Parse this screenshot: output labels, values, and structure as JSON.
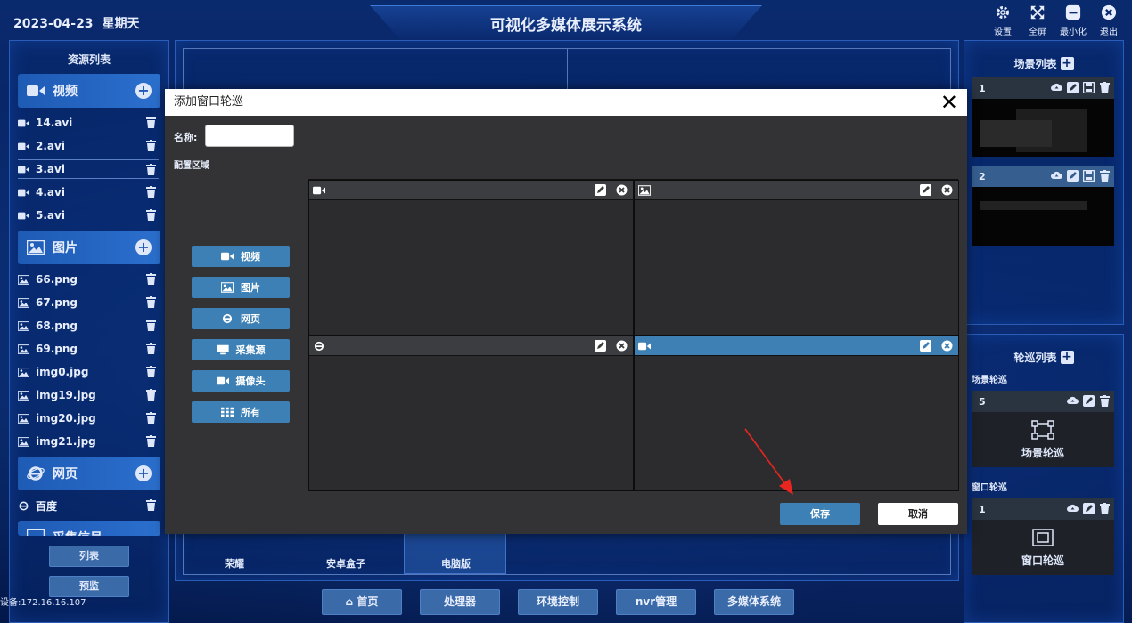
{
  "header": {
    "date": "2023-04-23",
    "weekday": "星期天",
    "title": "可视化多媒体展示系统",
    "controls": [
      {
        "label": "设置",
        "icon": "gear-icon"
      },
      {
        "label": "全屏",
        "icon": "fullscreen-icon"
      },
      {
        "label": "最小化",
        "icon": "minimize-icon"
      },
      {
        "label": "退出",
        "icon": "exit-icon"
      }
    ]
  },
  "left_panel": {
    "title": "资源列表",
    "video": {
      "label": "视频",
      "items": [
        "14.avi",
        "2.avi",
        "3.avi",
        "4.avi",
        "5.avi"
      ]
    },
    "image": {
      "label": "图片",
      "items": [
        "66.png",
        "67.png",
        "68.png",
        "69.png",
        "img0.jpg",
        "img19.jpg",
        "img20.jpg",
        "img21.jpg"
      ]
    },
    "web": {
      "label": "网页",
      "items": [
        "百度"
      ]
    },
    "capture": {
      "label": "采集信号"
    },
    "list_button": "列表",
    "preview_button": "预监",
    "device_ip": "设备:172.16.16.107"
  },
  "center": {
    "devices": [
      "荣耀",
      "安卓盒子",
      "电脑版"
    ]
  },
  "bottom_nav": [
    "首页",
    "处理器",
    "环境控制",
    "nvr管理",
    "多媒体系统"
  ],
  "right_panel": {
    "scene_title": "场景列表",
    "scenes": [
      {
        "index": "1"
      },
      {
        "index": "2"
      }
    ],
    "tour_title": "轮巡列表",
    "scene_tour_label": "场景轮巡",
    "scene_tour": {
      "index": "5",
      "name": "场景轮巡"
    },
    "window_tour_label": "窗口轮巡",
    "window_tour": {
      "index": "1",
      "name": "窗口轮巡"
    }
  },
  "modal": {
    "title": "添加窗口轮巡",
    "name_label": "名称:",
    "name_value": "",
    "config_label": "配置区域",
    "source_buttons": [
      {
        "label": "视频",
        "icon": "video-icon"
      },
      {
        "label": "图片",
        "icon": "image-icon"
      },
      {
        "label": "网页",
        "icon": "ie-icon"
      },
      {
        "label": "采集源",
        "icon": "monitor-icon"
      },
      {
        "label": "摄像头",
        "icon": "camera-icon"
      },
      {
        "label": "所有",
        "icon": "grid-icon"
      }
    ],
    "cells": [
      {
        "type": "video-icon",
        "active": false
      },
      {
        "type": "image-icon",
        "active": false
      },
      {
        "type": "ie-icon",
        "active": false
      },
      {
        "type": "video-icon",
        "active": true
      }
    ],
    "save": "保存",
    "cancel": "取消"
  },
  "colors": {
    "accent": "#3d80b5",
    "background": "#031a52",
    "modal": "#333335",
    "arrow": "#e8261f"
  }
}
